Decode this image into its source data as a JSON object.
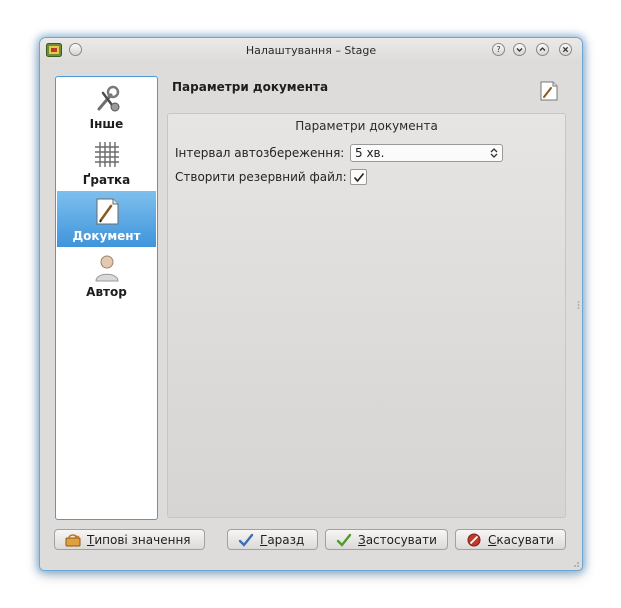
{
  "window": {
    "title": "Налаштування – Stage",
    "controls": [
      "help-icon",
      "minimize-icon",
      "maximize-icon",
      "close-icon"
    ]
  },
  "sidebar": {
    "items": [
      {
        "label": "Інше",
        "icon": "tools-icon",
        "selected": false
      },
      {
        "label": "Ґратка",
        "icon": "grid-icon",
        "selected": false
      },
      {
        "label": "Документ",
        "icon": "document-icon",
        "selected": true
      },
      {
        "label": "Автор",
        "icon": "user-icon",
        "selected": false
      }
    ]
  },
  "page": {
    "title": "Параметри документа",
    "icon": "document-icon"
  },
  "group": {
    "title": "Параметри документа",
    "autosave_label": "Інтервал автозбереження:",
    "autosave_value": "5 хв.",
    "backup_label": "Створити резервний файл:",
    "backup_checked": true
  },
  "buttons": {
    "defaults": {
      "mnemonic": "Т",
      "rest": "ипові значення",
      "icon": "reset-icon"
    },
    "ok": {
      "mnemonic": "Г",
      "rest": "аразд",
      "icon": "check-icon"
    },
    "apply": {
      "mnemonic": "З",
      "rest": "астосувати",
      "icon": "check-icon"
    },
    "cancel": {
      "mnemonic": "С",
      "rest": "касувати",
      "icon": "cancel-icon"
    }
  },
  "colors": {
    "selection": "#3f94db",
    "window_bg": "#dedcda",
    "focus_border": "#4a9bd8"
  }
}
